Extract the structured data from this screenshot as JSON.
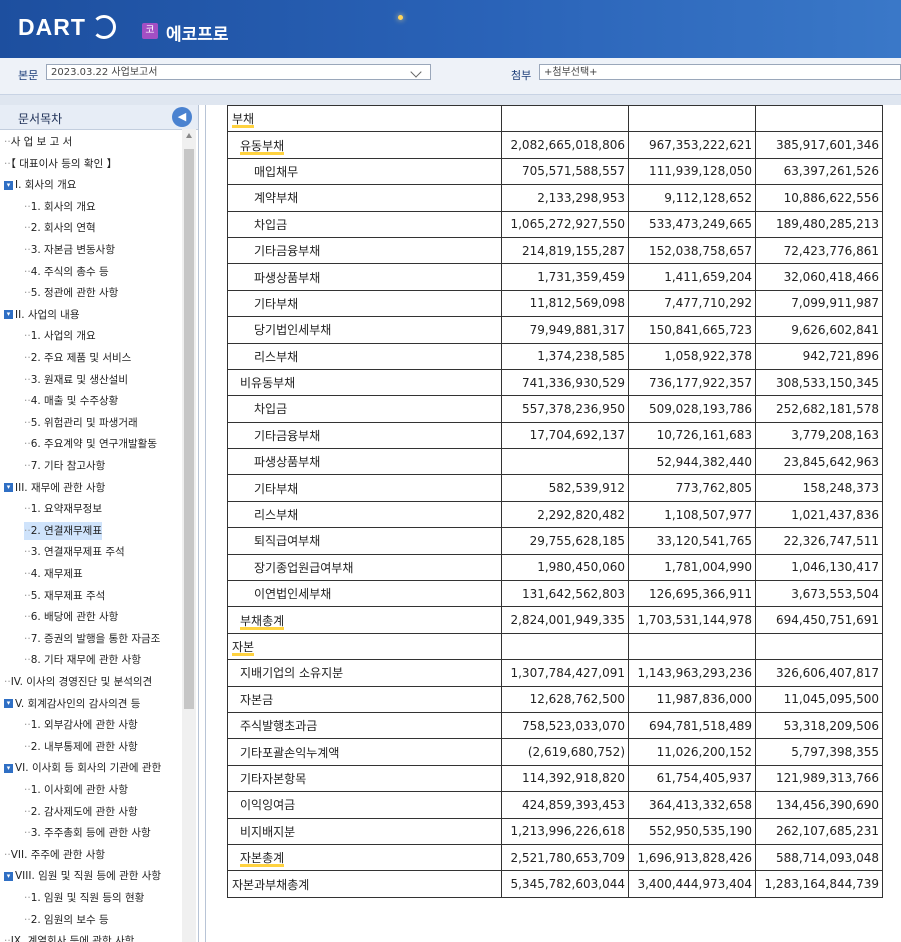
{
  "header": {
    "logo": "DART",
    "company_badge": "코",
    "company_name": "에코프로"
  },
  "docbar": {
    "body_label": "본문",
    "body_value": "2023.03.22  사업보고서",
    "attach_label": "첨부",
    "attach_value": "+첨부선택+"
  },
  "sidebar": {
    "title": "문서목차",
    "items": [
      {
        "label": "사 업 보 고 서",
        "level": 0,
        "toggle": false
      },
      {
        "label": "【 대표이사 등의 확인 】",
        "level": 0,
        "toggle": false
      },
      {
        "label": "I. 회사의 개요",
        "level": 0,
        "toggle": true
      },
      {
        "label": "1. 회사의 개요",
        "level": 1,
        "toggle": false
      },
      {
        "label": "2. 회사의 연혁",
        "level": 1,
        "toggle": false
      },
      {
        "label": "3. 자본금 변동사항",
        "level": 1,
        "toggle": false
      },
      {
        "label": "4. 주식의 총수 등",
        "level": 1,
        "toggle": false
      },
      {
        "label": "5. 정관에 관한 사항",
        "level": 1,
        "toggle": false
      },
      {
        "label": "II. 사업의 내용",
        "level": 0,
        "toggle": true
      },
      {
        "label": "1. 사업의 개요",
        "level": 1,
        "toggle": false
      },
      {
        "label": "2. 주요 제품 및 서비스",
        "level": 1,
        "toggle": false
      },
      {
        "label": "3. 원재료 및 생산설비",
        "level": 1,
        "toggle": false
      },
      {
        "label": "4. 매출 및 수주상황",
        "level": 1,
        "toggle": false
      },
      {
        "label": "5. 위험관리 및 파생거래",
        "level": 1,
        "toggle": false
      },
      {
        "label": "6. 주요계약 및 연구개발활동",
        "level": 1,
        "toggle": false
      },
      {
        "label": "7. 기타 참고사항",
        "level": 1,
        "toggle": false
      },
      {
        "label": "III. 재무에 관한 사항",
        "level": 0,
        "toggle": true
      },
      {
        "label": "1. 요약재무정보",
        "level": 1,
        "toggle": false
      },
      {
        "label": "2. 연결재무제표",
        "level": 1,
        "toggle": false,
        "selected": true
      },
      {
        "label": "3. 연결재무제표 주석",
        "level": 1,
        "toggle": false
      },
      {
        "label": "4. 재무제표",
        "level": 1,
        "toggle": false
      },
      {
        "label": "5. 재무제표 주석",
        "level": 1,
        "toggle": false
      },
      {
        "label": "6. 배당에 관한 사항",
        "level": 1,
        "toggle": false
      },
      {
        "label": "7. 증권의 발행을 통한 자금조",
        "level": 1,
        "toggle": false
      },
      {
        "label": "8. 기타 재무에 관한 사항",
        "level": 1,
        "toggle": false
      },
      {
        "label": "IV. 이사의 경영진단 및 분석의견",
        "level": 0,
        "toggle": false
      },
      {
        "label": "V. 회계감사인의 감사의견 등",
        "level": 0,
        "toggle": true
      },
      {
        "label": "1. 외부감사에 관한 사항",
        "level": 1,
        "toggle": false
      },
      {
        "label": "2. 내부통제에 관한 사항",
        "level": 1,
        "toggle": false
      },
      {
        "label": "VI. 이사회 등 회사의 기관에 관한",
        "level": 0,
        "toggle": true
      },
      {
        "label": "1. 이사회에 관한 사항",
        "level": 1,
        "toggle": false
      },
      {
        "label": "2. 감사제도에 관한 사항",
        "level": 1,
        "toggle": false
      },
      {
        "label": "3. 주주총회 등에 관한 사항",
        "level": 1,
        "toggle": false
      },
      {
        "label": "VII. 주주에 관한 사항",
        "level": 0,
        "toggle": false
      },
      {
        "label": "VIII. 임원 및 직원 등에 관한 사항",
        "level": 0,
        "toggle": true
      },
      {
        "label": "1. 임원 및 직원 등의 현황",
        "level": 1,
        "toggle": false
      },
      {
        "label": "2. 임원의 보수 등",
        "level": 1,
        "toggle": false
      },
      {
        "label": "IX. 계열회사 등에 관한 사항",
        "level": 0,
        "toggle": false
      }
    ]
  },
  "table": {
    "rows": [
      {
        "label": "부채",
        "level": 0,
        "hl": true,
        "values": [
          "",
          "",
          ""
        ]
      },
      {
        "label": "유동부채",
        "level": 1,
        "hl": true,
        "values": [
          "2,082,665,018,806",
          "967,353,222,621",
          "385,917,601,346"
        ]
      },
      {
        "label": "매입채무",
        "level": 2,
        "values": [
          "705,571,588,557",
          "111,939,128,050",
          "63,397,261,526"
        ]
      },
      {
        "label": "계약부채",
        "level": 2,
        "values": [
          "2,133,298,953",
          "9,112,128,652",
          "10,886,622,556"
        ]
      },
      {
        "label": "차입금",
        "level": 2,
        "values": [
          "1,065,272,927,550",
          "533,473,249,665",
          "189,480,285,213"
        ]
      },
      {
        "label": "기타금융부채",
        "level": 2,
        "values": [
          "214,819,155,287",
          "152,038,758,657",
          "72,423,776,861"
        ]
      },
      {
        "label": "파생상품부채",
        "level": 2,
        "values": [
          "1,731,359,459",
          "1,411,659,204",
          "32,060,418,466"
        ]
      },
      {
        "label": "기타부채",
        "level": 2,
        "values": [
          "11,812,569,098",
          "7,477,710,292",
          "7,099,911,987"
        ]
      },
      {
        "label": "당기법인세부채",
        "level": 2,
        "values": [
          "79,949,881,317",
          "150,841,665,723",
          "9,626,602,841"
        ]
      },
      {
        "label": "리스부채",
        "level": 2,
        "values": [
          "1,374,238,585",
          "1,058,922,378",
          "942,721,896"
        ]
      },
      {
        "label": "비유동부채",
        "level": 1,
        "values": [
          "741,336,930,529",
          "736,177,922,357",
          "308,533,150,345"
        ]
      },
      {
        "label": "차입금",
        "level": 2,
        "values": [
          "557,378,236,950",
          "509,028,193,786",
          "252,682,181,578"
        ]
      },
      {
        "label": "기타금융부채",
        "level": 2,
        "values": [
          "17,704,692,137",
          "10,726,161,683",
          "3,779,208,163"
        ]
      },
      {
        "label": "파생상품부채",
        "level": 2,
        "values": [
          "",
          "52,944,382,440",
          "23,845,642,963"
        ]
      },
      {
        "label": "기타부채",
        "level": 2,
        "values": [
          "582,539,912",
          "773,762,805",
          "158,248,373"
        ]
      },
      {
        "label": "리스부채",
        "level": 2,
        "values": [
          "2,292,820,482",
          "1,108,507,977",
          "1,021,437,836"
        ]
      },
      {
        "label": "퇴직급여부채",
        "level": 2,
        "values": [
          "29,755,628,185",
          "33,120,541,765",
          "22,326,747,511"
        ]
      },
      {
        "label": "장기종업원급여부채",
        "level": 2,
        "values": [
          "1,980,450,060",
          "1,781,004,990",
          "1,046,130,417"
        ]
      },
      {
        "label": "이연법인세부채",
        "level": 2,
        "values": [
          "131,642,562,803",
          "126,695,366,911",
          "3,673,553,504"
        ]
      },
      {
        "label": "부채총계",
        "level": 1,
        "hl": true,
        "values": [
          "2,824,001,949,335",
          "1,703,531,144,978",
          "694,450,751,691"
        ]
      },
      {
        "label": "자본",
        "level": 0,
        "hl": true,
        "values": [
          "",
          "",
          ""
        ]
      },
      {
        "label": "지배기업의 소유지분",
        "level": 1,
        "values": [
          "1,307,784,427,091",
          "1,143,963,293,236",
          "326,606,407,817"
        ]
      },
      {
        "label": "자본금",
        "level": 1,
        "values": [
          "12,628,762,500",
          "11,987,836,000",
          "11,045,095,500"
        ]
      },
      {
        "label": "주식발행초과금",
        "level": 1,
        "values": [
          "758,523,033,070",
          "694,781,518,489",
          "53,318,209,506"
        ]
      },
      {
        "label": "기타포괄손익누계액",
        "level": 1,
        "values": [
          "(2,619,680,752)",
          "11,026,200,152",
          "5,797,398,355"
        ]
      },
      {
        "label": "기타자본항목",
        "level": 1,
        "values": [
          "114,392,918,820",
          "61,754,405,937",
          "121,989,313,766"
        ]
      },
      {
        "label": "이익잉여금",
        "level": 1,
        "values": [
          "424,859,393,453",
          "364,413,332,658",
          "134,456,390,690"
        ]
      },
      {
        "label": "비지배지분",
        "level": 1,
        "values": [
          "1,213,996,226,618",
          "552,950,535,190",
          "262,107,685,231"
        ]
      },
      {
        "label": "자본총계",
        "level": 1,
        "hl": true,
        "values": [
          "2,521,780,653,709",
          "1,696,913,828,426",
          "588,714,093,048"
        ]
      },
      {
        "label": "자본과부채총계",
        "level": 0,
        "values": [
          "5,345,782,603,044",
          "3,400,444,973,404",
          "1,283,164,844,739"
        ]
      }
    ]
  },
  "colors": {
    "header_bg": "#2a63b8",
    "highlight": "#ffd23f",
    "selected": "#cfe3fb"
  }
}
